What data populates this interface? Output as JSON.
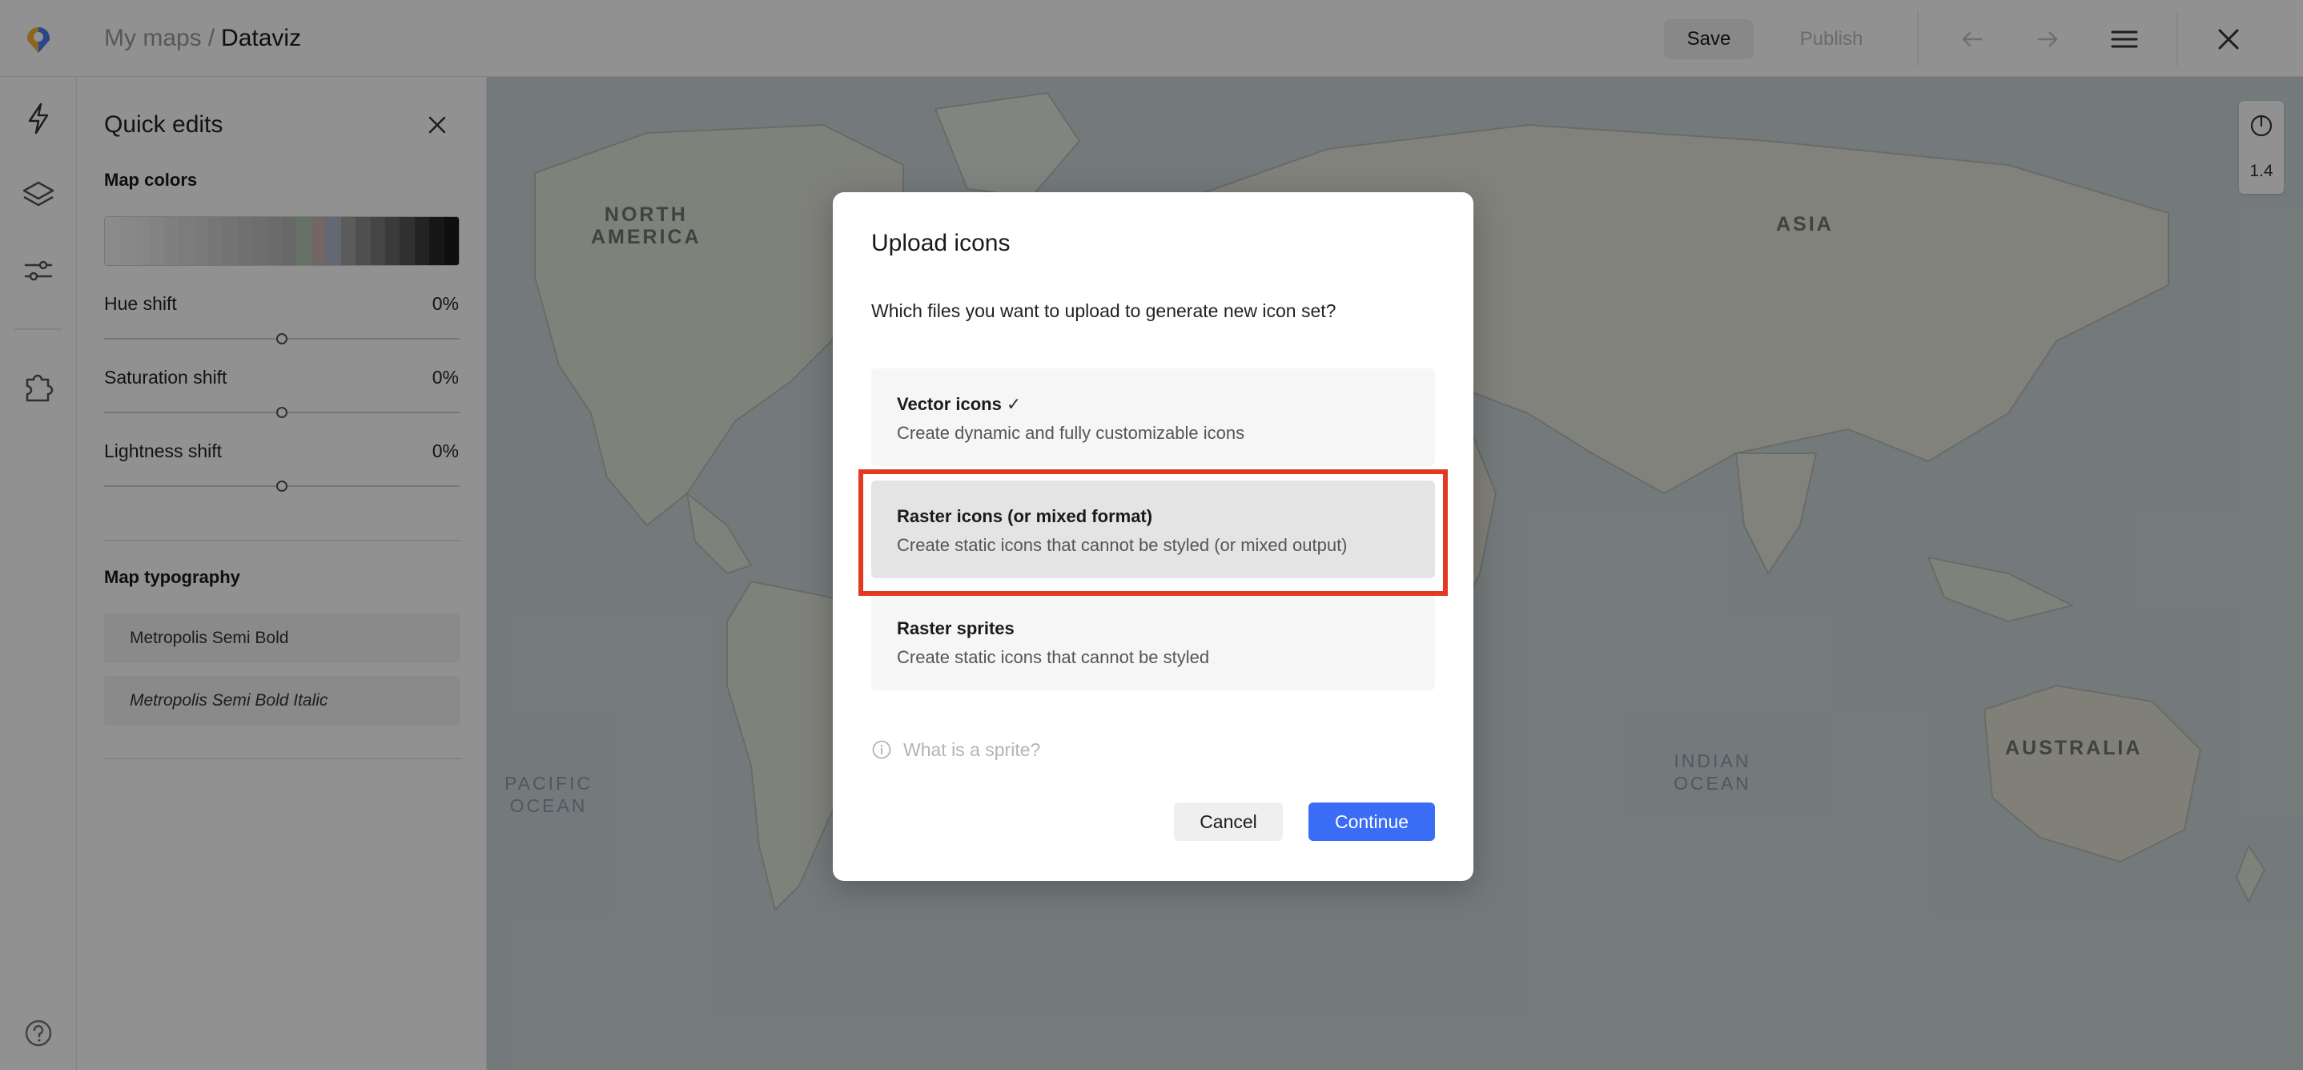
{
  "header": {
    "breadcrumb_parent": "My maps",
    "breadcrumb_separator": "/",
    "breadcrumb_current": "Dataviz",
    "save_label": "Save",
    "publish_label": "Publish",
    "icons": [
      "back-arrow-icon",
      "forward-arrow-icon",
      "hamburger-menu-icon",
      "close-icon"
    ]
  },
  "rail": {
    "icons": [
      "lightning-icon",
      "layers-icon",
      "sliders-icon",
      "puzzle-icon",
      "help-icon"
    ]
  },
  "panel": {
    "title": "Quick edits",
    "map_colors_title": "Map colors",
    "color_swatches": [
      "#f4f4f4",
      "#efefef",
      "#ebebeb",
      "#e6e6e6",
      "#e0e0e0",
      "#dadada",
      "#d6d6d6",
      "#d0d0d0",
      "#cbcbcb",
      "#c6c6c6",
      "#c2c2c2",
      "#bcbcbc",
      "#b8b8b8",
      "#b3c8b3",
      "#c9b4b4",
      "#b1b8c8",
      "#a0a0a0",
      "#8c8c8c",
      "#7a7a7a",
      "#686868",
      "#555555",
      "#3e3e3e",
      "#2a2a2a",
      "#1c1c1c"
    ],
    "sliders": [
      {
        "label": "Hue shift",
        "value": "0%",
        "level": 0.5
      },
      {
        "label": "Saturation shift",
        "value": "0%",
        "level": 0.5
      },
      {
        "label": "Lightness shift",
        "value": "0%",
        "level": 0.5
      }
    ],
    "typography_title": "Map typography",
    "fonts": [
      "Metropolis Semi Bold",
      "Metropolis Semi Bold Italic"
    ]
  },
  "map": {
    "labels": {
      "north_america": "NORTH\nAMERICA",
      "asia": "ASIA",
      "pacific_ocean": "PACIFIC\nOCEAN",
      "indian_ocean": "INDIAN\nOCEAN",
      "australia": "AUSTRALIA"
    },
    "zoom": "1.4"
  },
  "modal": {
    "title": "Upload icons",
    "question": "Which files you want to upload to generate new icon set?",
    "options": [
      {
        "title": "Vector icons",
        "check": "✓",
        "desc": "Create dynamic and fully customizable icons"
      },
      {
        "title": "Raster icons (or mixed format)",
        "desc": "Create static icons that cannot be styled (or mixed output)"
      },
      {
        "title": "Raster sprites",
        "desc": "Create static icons that cannot be styled"
      }
    ],
    "selected_option": 1,
    "info_link": "What is a sprite?",
    "cancel_label": "Cancel",
    "continue_label": "Continue"
  },
  "colors": {
    "accent": "#3b6cf5",
    "highlight": "#e23a22"
  }
}
